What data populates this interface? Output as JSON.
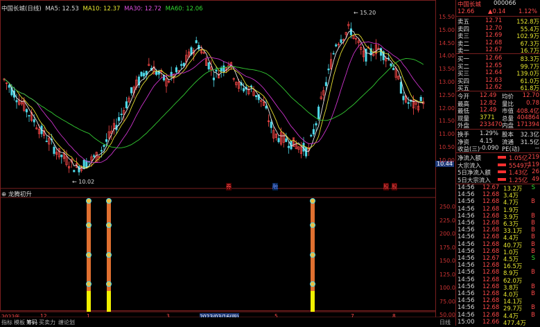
{
  "main_header": {
    "title": "中国长城(日线)",
    "ma5": "MA5: 12.53",
    "ma10": "MA10: 12.37",
    "ma30": "MA30: 12.72",
    "ma60": "MA60: 12.06"
  },
  "price_axis": [
    "15.50",
    "15.00",
    "14.50",
    "14.00",
    "13.50",
    "13.00",
    "12.50",
    "12.00",
    "11.50",
    "11.00",
    "10.50",
    "10.00"
  ],
  "price_current_tag": "10.44",
  "annotations": {
    "high": "15.20",
    "low": "10.02"
  },
  "events": {
    "a": "券",
    "b": "融",
    "c": "股",
    "d": "股"
  },
  "indicator_header": "龙腾初升",
  "indicator_axis": [
    "250.00",
    "225.00",
    "200.00",
    "175.00",
    "150.00",
    "125.00",
    "100.00",
    "75.00",
    "50.00"
  ],
  "date_axis": {
    "left": "2022年",
    "m12": "12",
    "m1": "1",
    "m3": "3",
    "m5": "5",
    "m7": "7",
    "m8": "8",
    "crosshair": "2023/03/16(四)"
  },
  "bottom_tabs": [
    "指标",
    "模板",
    "筹码",
    "买卖力",
    "缠论划"
  ],
  "bottom_right": "日线",
  "side": {
    "name": "中国长城",
    "code": "000066",
    "price": "12.66",
    "change": "▲0.14",
    "pct": "1.12%",
    "asks": [
      {
        "label": "卖五",
        "price": "12.71",
        "vol": "152.8万"
      },
      {
        "label": "卖四",
        "price": "12.70",
        "vol": "55.4万"
      },
      {
        "label": "卖三",
        "price": "12.69",
        "vol": "102.9万"
      },
      {
        "label": "卖二",
        "price": "12.68",
        "vol": "67.3万"
      },
      {
        "label": "卖一",
        "price": "12.67",
        "vol": "16.7万"
      }
    ],
    "bids": [
      {
        "label": "买一",
        "price": "12.66",
        "vol": "83.3万"
      },
      {
        "label": "买二",
        "price": "12.65",
        "vol": "99.7万"
      },
      {
        "label": "买三",
        "price": "12.64",
        "vol": "139.0万"
      },
      {
        "label": "买四",
        "price": "12.63",
        "vol": "61.0万"
      },
      {
        "label": "买五",
        "price": "12.62",
        "vol": "61.8万"
      }
    ],
    "stats": [
      {
        "l1": "今开",
        "v1": "12.49",
        "l2": "均价",
        "v2": "12.70"
      },
      {
        "l1": "最高",
        "v1": "12.82",
        "l2": "量比",
        "v2": "0.78"
      },
      {
        "l1": "最低",
        "v1": "12.49",
        "l2": "市值",
        "v2": "408.4亿"
      },
      {
        "l1": "现量",
        "v1": "3771",
        "l2": "总量",
        "v2": "404864"
      },
      {
        "l1": "外盘",
        "v1": "233470",
        "l2": "内盘",
        "v2": "171394"
      }
    ],
    "stats2": [
      {
        "l1": "换手",
        "v1": "1.29%",
        "l2": "股本",
        "v2": "32.3亿"
      },
      {
        "l1": "净资",
        "v1": "4.15",
        "l2": "流通",
        "v2": "31.5亿"
      },
      {
        "l1": "收益(三)",
        "v1": "-0.090",
        "l2": "PE(动)",
        "v2": "--"
      }
    ],
    "flows": [
      {
        "label": "净流入额",
        "val": "1.05亿",
        "extra": "219"
      },
      {
        "label": "大宗流入",
        "val": "5549万",
        "extra": "119"
      },
      {
        "label": "5日净流入额",
        "val": "1.43亿",
        "extra": "26"
      },
      {
        "label": "5日大宗流入",
        "val": "1.25亿",
        "extra": "49"
      }
    ],
    "ticks": [
      {
        "t": "14:56",
        "p": "12.67",
        "v": "13.2万",
        "s": "S"
      },
      {
        "t": "14:56",
        "p": "12.68",
        "v": "3.4万",
        "s": ""
      },
      {
        "t": "14:56",
        "p": "12.68",
        "v": "4.7万",
        "s": "B"
      },
      {
        "t": "14:56",
        "p": "12.68",
        "v": "1.9万",
        "s": ""
      },
      {
        "t": "14:56",
        "p": "12.68",
        "v": "3.9万",
        "s": "B"
      },
      {
        "t": "14:56",
        "p": "12.68",
        "v": "6.3万",
        "s": "B"
      },
      {
        "t": "14:56",
        "p": "12.68",
        "v": "33.1万",
        "s": "B"
      },
      {
        "t": "14:56",
        "p": "12.68",
        "v": "4.4万",
        "s": "B"
      },
      {
        "t": "14:56",
        "p": "12.68",
        "v": "40.7万",
        "s": "B"
      },
      {
        "t": "14:56",
        "p": "12.68",
        "v": "1.0万",
        "s": "B"
      },
      {
        "t": "14:56",
        "p": "12.67",
        "v": "4.5万",
        "s": "S"
      },
      {
        "t": "14:56",
        "p": "12.68",
        "v": "16.5万",
        "s": ""
      },
      {
        "t": "14:56",
        "p": "12.68",
        "v": "8.9万",
        "s": "B"
      },
      {
        "t": "14:56",
        "p": "12.68",
        "v": "62.0万",
        "s": ""
      },
      {
        "t": "14:56",
        "p": "12.68",
        "v": "3.8万",
        "s": "B"
      },
      {
        "t": "14:56",
        "p": "12.68",
        "v": "4.0万",
        "s": "B"
      },
      {
        "t": "14:56",
        "p": "12.68",
        "v": "14.1万",
        "s": ""
      },
      {
        "t": "14:56",
        "p": "12.68",
        "v": "29.7万",
        "s": "B"
      },
      {
        "t": "14:56",
        "p": "12.68",
        "v": "4.4万",
        "s": "B"
      },
      {
        "t": "15:00",
        "p": "12.66",
        "v": "477.4万",
        "s": ""
      }
    ]
  },
  "colors": {
    "up": "#ff4a4a",
    "down": "#4ed8e8",
    "ma5": "#e8e8e8",
    "ma10": "#e8e030",
    "ma30": "#cc33cc",
    "ma60": "#33cc33",
    "frame": "#7a1f1f"
  }
}
